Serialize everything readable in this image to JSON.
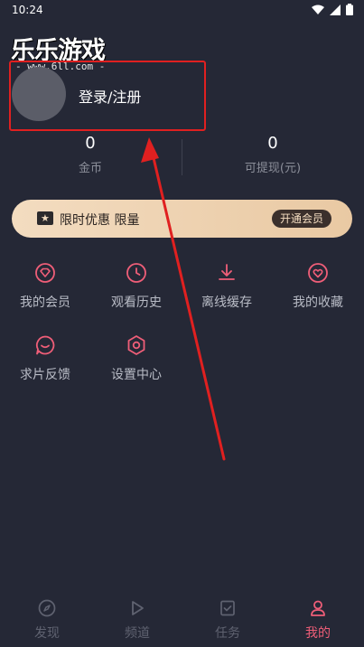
{
  "status_bar": {
    "time": "10:24"
  },
  "watermark": {
    "logo": "乐乐游戏",
    "url": "- www.6ll.com -"
  },
  "profile": {
    "login_label": "登录/注册"
  },
  "stats": [
    {
      "value": "0",
      "label": "金币"
    },
    {
      "value": "0",
      "label": "可提现(元)"
    }
  ],
  "vip_banner": {
    "text": "限时优惠 限量",
    "button": "开通会员"
  },
  "menu": [
    {
      "label": "我的会员",
      "icon": "diamond-icon"
    },
    {
      "label": "观看历史",
      "icon": "clock-icon"
    },
    {
      "label": "离线缓存",
      "icon": "download-icon"
    },
    {
      "label": "我的收藏",
      "icon": "heart-icon"
    },
    {
      "label": "求片反馈",
      "icon": "chat-icon"
    },
    {
      "label": "设置中心",
      "icon": "settings-icon"
    }
  ],
  "tabs": [
    {
      "label": "发现",
      "icon": "compass-icon",
      "active": false
    },
    {
      "label": "频道",
      "icon": "play-icon",
      "active": false
    },
    {
      "label": "任务",
      "icon": "task-icon",
      "active": false
    },
    {
      "label": "我的",
      "icon": "user-icon",
      "active": true
    }
  ],
  "colors": {
    "accent": "#ef5e78",
    "background": "#252836",
    "highlight": "#e02020",
    "vip_gold": "#f3dcc0"
  }
}
